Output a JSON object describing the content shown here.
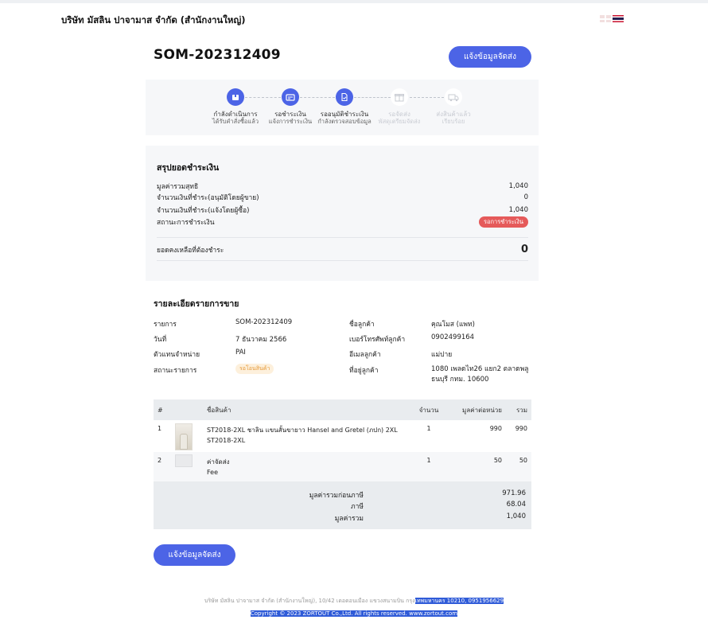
{
  "header": {
    "company_name": "บริษัท มัสลิน ปาจามาส จำกัด (สำนักงานใหญ่)",
    "lang_flags": [
      "uk-flag-icon",
      "th-flag-icon"
    ]
  },
  "order": {
    "number": "SOM-202312409",
    "notify_button": "แจ้งข้อมูลจัดส่ง"
  },
  "steps": [
    {
      "title": "กำลังดำเนินการ",
      "sub": "ได้รับคำสั่งซื้อแล้ว",
      "icon": "box-icon",
      "active": true
    },
    {
      "title": "รอชำระเงิน",
      "sub": "แจ้งการชำระเงิน",
      "icon": "payment-card-icon",
      "active": true
    },
    {
      "title": "รออนุมัติชำระเงิน",
      "sub": "กำลังตรวจสอบข้อมูล",
      "icon": "document-check-icon",
      "active": true
    },
    {
      "title": "รอจัดส่ง",
      "sub": "พัสดุเตรียมจัดส่ง",
      "icon": "gift-box-icon",
      "active": false
    },
    {
      "title": "ส่งสินค้าแล้ว",
      "sub": "เรียบร้อย",
      "icon": "truck-icon",
      "active": false
    }
  ],
  "summary": {
    "title": "สรุปยอดชำระเงิน",
    "rows": [
      {
        "label": "มูลค่ารวมสุทธิ",
        "value": "1,040"
      },
      {
        "label": "จำนวนเงินที่ชำระ(อนุมัติโดยผู้ขาย)",
        "value": "0"
      },
      {
        "label": "จำนวนเงินที่ชำระ(แจ้งโดยผู้ซื้อ)",
        "value": "1,040"
      }
    ],
    "status_label": "สถานะการชำระเงิน",
    "status_badge": "รอการชำระเงิน",
    "remaining_label": "ยอดคงเหลือที่ต้องชำระ",
    "remaining_value": "0"
  },
  "details": {
    "title": "รายละเอียดรายการขาย",
    "left": [
      {
        "label": "รายการ",
        "value": "SOM-202312409"
      },
      {
        "label": "วันที่",
        "value": "7 ธันวาคม 2566"
      },
      {
        "label": "ตัวแทนจำหน่าย",
        "value": "PAI"
      },
      {
        "label": "สถานะรายการ",
        "value": "รอโอนสินค้า"
      }
    ],
    "right": [
      {
        "label": "ชื่อลูกค้า",
        "value": "คุณโมส (แพท)"
      },
      {
        "label": "เบอร์โทรศัพท์ลูกค้า",
        "value": "0902499164"
      },
      {
        "label": "อีเมลลูกค้า",
        "value": "แม่ปาย"
      },
      {
        "label": "ที่อยู่ลูกค้า",
        "value": "1080 เพลดไท26 แยก2 ตลาดพลู",
        "value2": "ธนบุรี กทม. 10600"
      }
    ]
  },
  "items": {
    "headers": [
      "#",
      "ชื่อสินค้า",
      "จำนวน",
      "มูลค่าต่อหน่วย",
      "รวม"
    ],
    "rows": [
      {
        "no": "1",
        "name": "ST2018-2XL ชาลิน แขนสั้นขายาว Hansel and Gretel (ภปก) 2XL",
        "sku": "ST2018-2XL",
        "qty": "1",
        "unit": "990",
        "total": "990"
      },
      {
        "no": "2",
        "name": "ค่าจัดส่ง",
        "sku": "Fee",
        "qty": "1",
        "unit": "50",
        "total": "50"
      }
    ],
    "totals": [
      {
        "label": "มูลค่ารวมก่อนภาษี",
        "value": "971.96"
      },
      {
        "label": "ภาษี",
        "value": "68.04"
      },
      {
        "label": "มูลค่ารวม",
        "value": "1,040"
      }
    ]
  },
  "footer": {
    "address_plain": "บริษัท มัสลิน ปาจามาส จำกัด (สำนักงานใหญ่), 10/42 เดอดอนเมือง แขวงสนามบิน กรุง",
    "address_highlight": "เทพมหานคร 10210, 0951956629",
    "copyright": "Copyright © 2023 ZORTOUT Co.,Ltd. All rights reserved. www.zortout.com"
  },
  "colors": {
    "accent": "#4c64e6",
    "danger": "#e55a5a",
    "warning_bg": "#fdf0dc",
    "warning_text": "#e69a3a"
  }
}
